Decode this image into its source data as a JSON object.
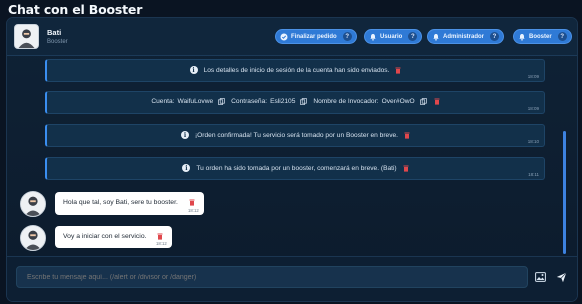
{
  "page": {
    "title": "Chat con el Booster"
  },
  "header": {
    "user_name": "Bati",
    "user_role": "Booster",
    "buttons": [
      {
        "label": "Finalizar pedido",
        "icon": "check-circle-icon",
        "help": "?"
      },
      {
        "label": "Usuario",
        "icon": "bell-icon",
        "help": "?"
      },
      {
        "label": "Administrador",
        "icon": "bell-icon",
        "help": "?"
      },
      {
        "label": "Booster",
        "icon": "bell-icon",
        "help": "?"
      }
    ]
  },
  "messages": {
    "system": [
      {
        "text": "Los detalles de inicio de sesión de la cuenta han sido enviados.",
        "time": "18:09"
      },
      {
        "account_label": "Cuenta:",
        "account_value": "WaifuLovwe",
        "password_label": "Contraseña:",
        "password_value": "Esli2105",
        "summoner_label": "Nombre de Invocador:",
        "summoner_value": "Over#OwO",
        "time": "18:09"
      },
      {
        "text": "¡Orden confirmada! Tu servicio será tomado por un Booster en breve.",
        "time": "18:10"
      },
      {
        "text": "Tu orden ha sido tomada por un booster, comenzará en breve. (Bati)",
        "time": "18:11"
      }
    ],
    "user": [
      {
        "text": "Hola que tal, soy Bati, sere tu booster.",
        "time": "18:12"
      },
      {
        "text": "Voy a iniciar con el servicio.",
        "time": "18:12"
      }
    ]
  },
  "composer": {
    "placeholder": "Escribe tu mensaje aquí... (/alert or /divisor or /danger)"
  },
  "colors": {
    "accent": "#2f7ad6",
    "delete": "#e0474c",
    "background": "#0a1422"
  }
}
